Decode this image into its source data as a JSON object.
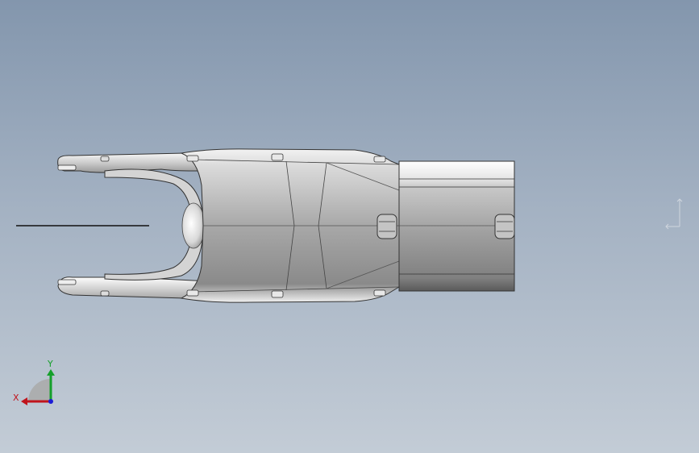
{
  "viewport": {
    "background_top": "#8396ad",
    "background_bottom": "#c3ccd6"
  },
  "triad": {
    "x_label": "X",
    "y_label": "Y",
    "x_color": "#c0141c",
    "y_color": "#15a02b",
    "z_color": "#1b1bd6"
  },
  "model": {
    "name_icon": "robot-arm-link-part-icon"
  }
}
